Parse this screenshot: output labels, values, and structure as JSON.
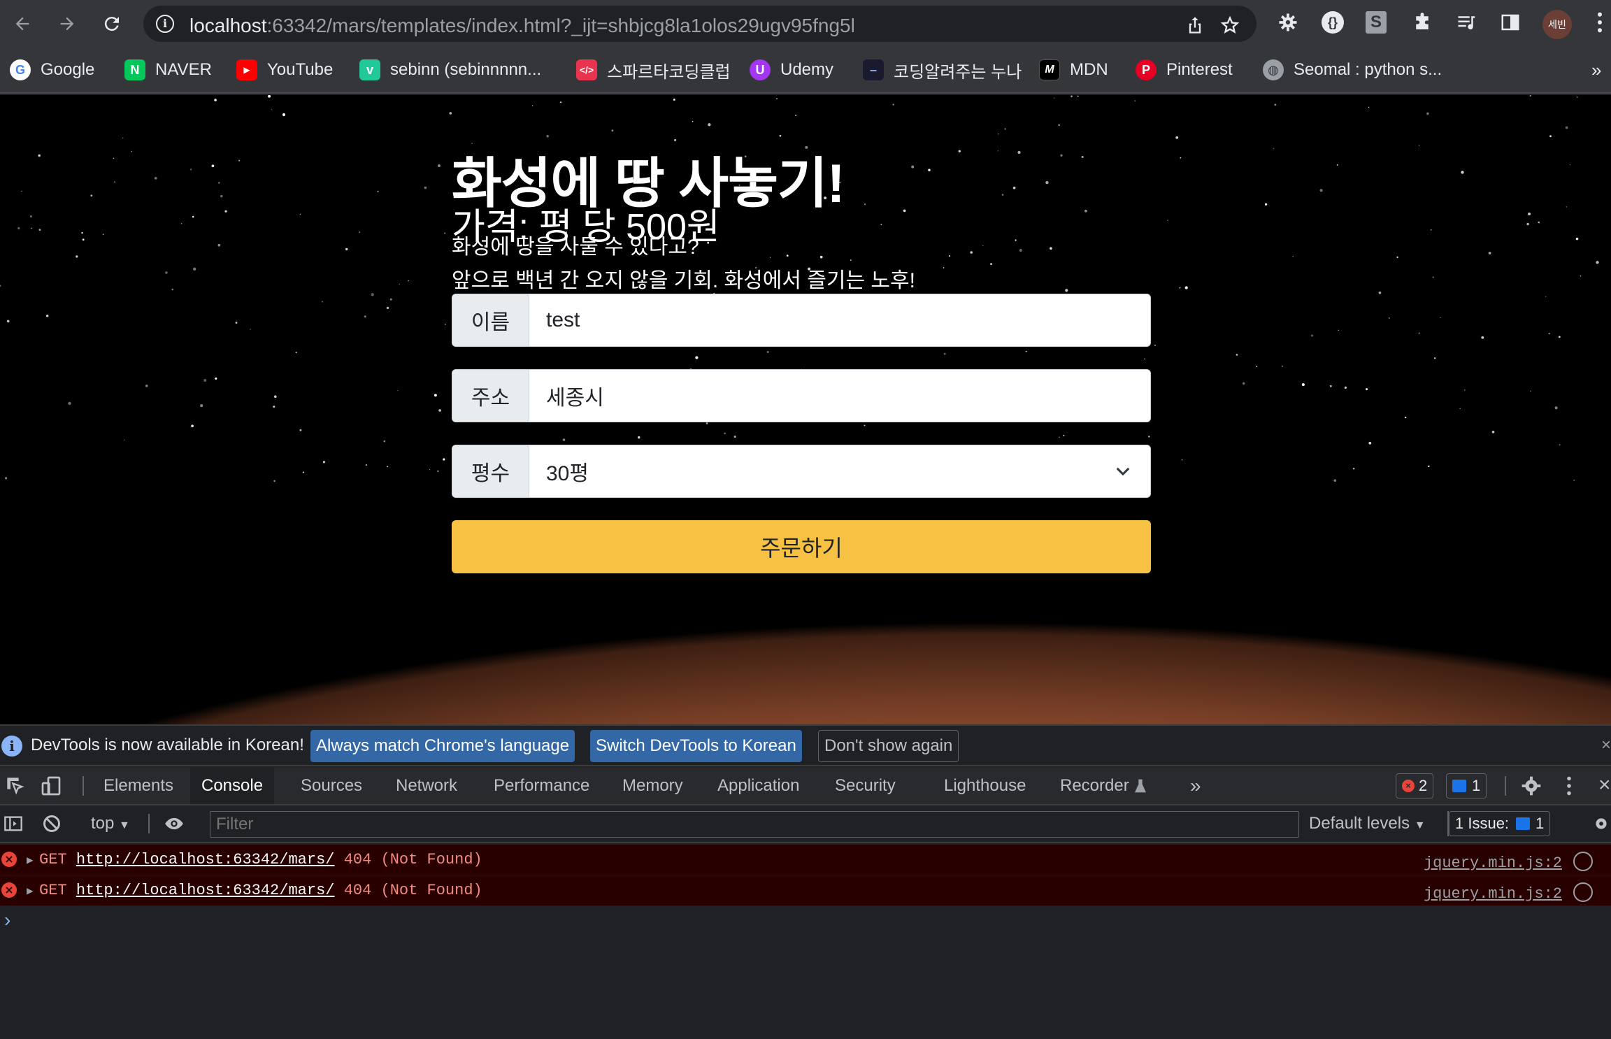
{
  "browser": {
    "url_host": "localhost",
    "url_rest": ":63342/mars/templates/index.html?_ijt=shbjcg8la1olos29ugv95fng5l",
    "profile_label": "세빈",
    "bookmarks": [
      {
        "label": "Google",
        "icon": "google-icon",
        "color": "#ffffff"
      },
      {
        "label": "NAVER",
        "icon": "naver-icon",
        "color": "#03c75a"
      },
      {
        "label": "YouTube",
        "icon": "youtube-icon",
        "color": "#ff0000"
      },
      {
        "label": "sebinn (sebinnnnn...",
        "icon": "velog-icon",
        "color": "#20c997"
      },
      {
        "label": "스파르타코딩클럽",
        "icon": "sparta-icon",
        "color": "#e8344e"
      },
      {
        "label": "Udemy",
        "icon": "udemy-icon",
        "color": "#a435f0"
      },
      {
        "label": "코딩알려주는 누나",
        "icon": "nuna-icon",
        "color": "#1a1a2e"
      },
      {
        "label": "MDN",
        "icon": "mdn-icon",
        "color": "#000000"
      },
      {
        "label": "Pinterest",
        "icon": "pinterest-icon",
        "color": "#e60023"
      },
      {
        "label": "Seomal : python s...",
        "icon": "globe-icon",
        "color": "#9aa0a6"
      }
    ],
    "more_bookmarks": "»"
  },
  "page": {
    "title": "화성에 땅 사놓기!",
    "price": "가격: 평 당 500원",
    "desc_line1": "화성에 땅을 사둘 수 있다고?",
    "desc_line2": "앞으로 백년 간 오지 않을 기회. 화성에서 즐기는 노후!",
    "form": {
      "name_label": "이름",
      "name_value": "test",
      "address_label": "주소",
      "address_value": "세종시",
      "size_label": "평수",
      "size_value": "30평",
      "submit_label": "주문하기"
    }
  },
  "devtools": {
    "banner_message": "DevTools is now available in Korean!",
    "btn_always": "Always match Chrome's language",
    "btn_switch": "Switch DevTools to Korean",
    "btn_dont": "Don't show again",
    "tabs": [
      "Elements",
      "Console",
      "Sources",
      "Network",
      "Performance",
      "Memory",
      "Application",
      "Security",
      "Lighthouse",
      "Recorder"
    ],
    "active_tab": "Console",
    "error_count": "2",
    "message_count": "1",
    "context": "top",
    "filter_placeholder": "Filter",
    "levels": "Default levels",
    "issues_label": "1 Issue:",
    "issues_count": "1",
    "logs": [
      {
        "method": "GET",
        "url": "http://localhost:63342/mars/",
        "status": "404 (Not Found)",
        "source": "jquery.min.js:2"
      },
      {
        "method": "GET",
        "url": "http://localhost:63342/mars/",
        "status": "404 (Not Found)",
        "source": "jquery.min.js:2"
      }
    ],
    "prompt": "›"
  }
}
